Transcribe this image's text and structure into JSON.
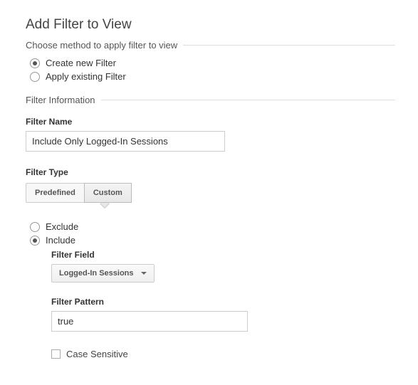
{
  "header": {
    "title": "Add Filter to View"
  },
  "method": {
    "legend": "Choose method to apply filter to view",
    "create_label": "Create new Filter",
    "apply_label": "Apply existing Filter",
    "selected": "create"
  },
  "info": {
    "legend": "Filter Information",
    "name_label": "Filter Name",
    "name_value": "Include Only Logged-In Sessions",
    "type_label": "Filter Type"
  },
  "type_tabs": {
    "predefined": "Predefined",
    "custom": "Custom",
    "selected": "custom"
  },
  "custom": {
    "exclude_label": "Exclude",
    "include_label": "Include",
    "selected": "include",
    "field_label": "Filter Field",
    "field_value": "Logged-In Sessions",
    "pattern_label": "Filter Pattern",
    "pattern_value": "true",
    "case_sensitive_label": "Case Sensitive",
    "case_sensitive_checked": false
  }
}
